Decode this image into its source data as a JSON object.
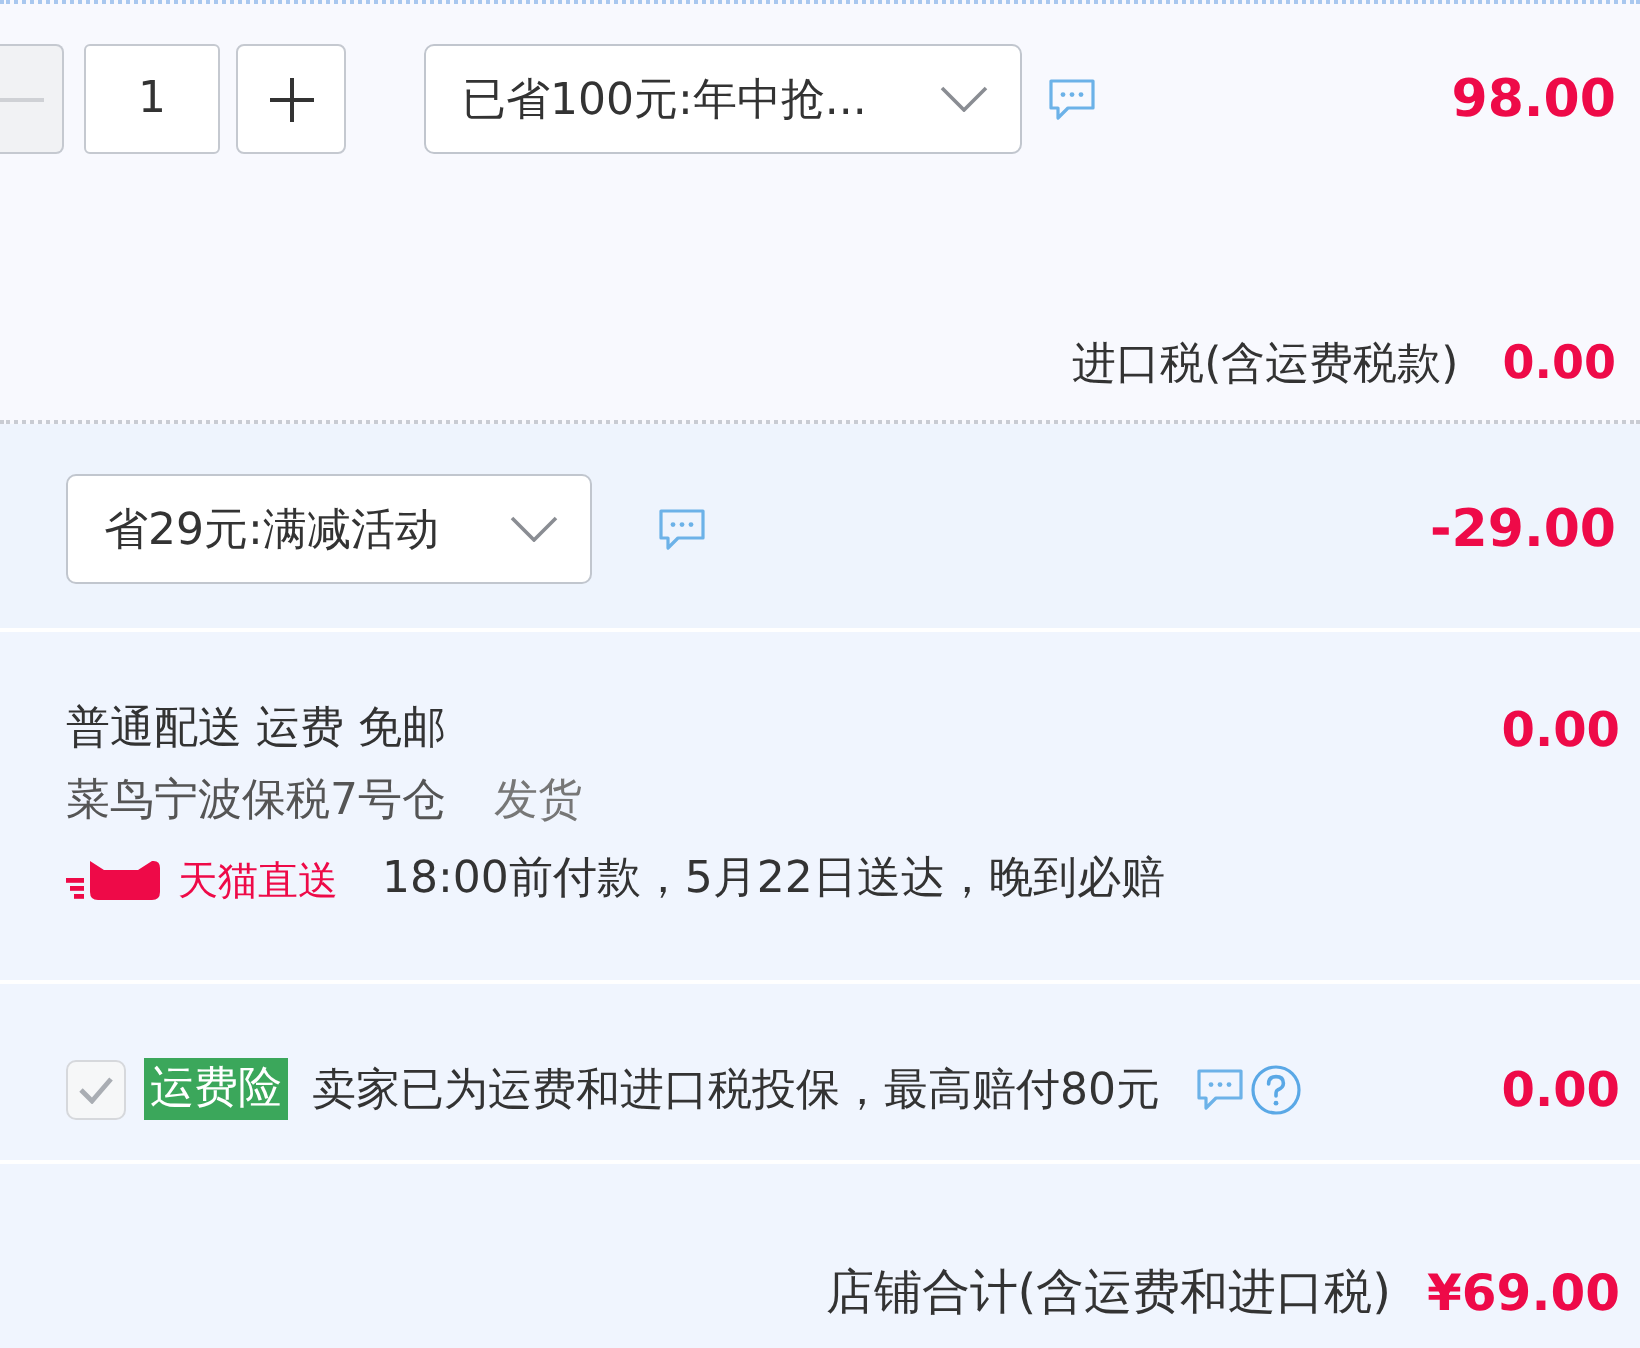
{
  "item": {
    "quantity": {
      "value": "1",
      "decrease_disabled": true
    },
    "promo_select": {
      "value": "已省100元:年中抢..."
    },
    "price": "98.00",
    "import_tax": {
      "label": "进口税(含运费税款)",
      "amount": "0.00"
    }
  },
  "shop_discount": {
    "select": {
      "value": "省29元:满减活动"
    },
    "amount": "-29.00"
  },
  "delivery": {
    "method": "普通配送 运费 免邮",
    "warehouse": "菜鸟宁波保税7号仓",
    "ship_label": "发货",
    "service": "天猫直送",
    "promise": "18:00前付款，5月22日送达，晚到必赔",
    "amount": "0.00"
  },
  "insurance": {
    "checked": true,
    "disabled": true,
    "tag": "运费险",
    "text": "卖家已为运费和进口税投保，最高赔付80元",
    "amount": "0.00"
  },
  "total": {
    "label": "店铺合计(含运费和进口税)",
    "amount": "¥69.00"
  }
}
